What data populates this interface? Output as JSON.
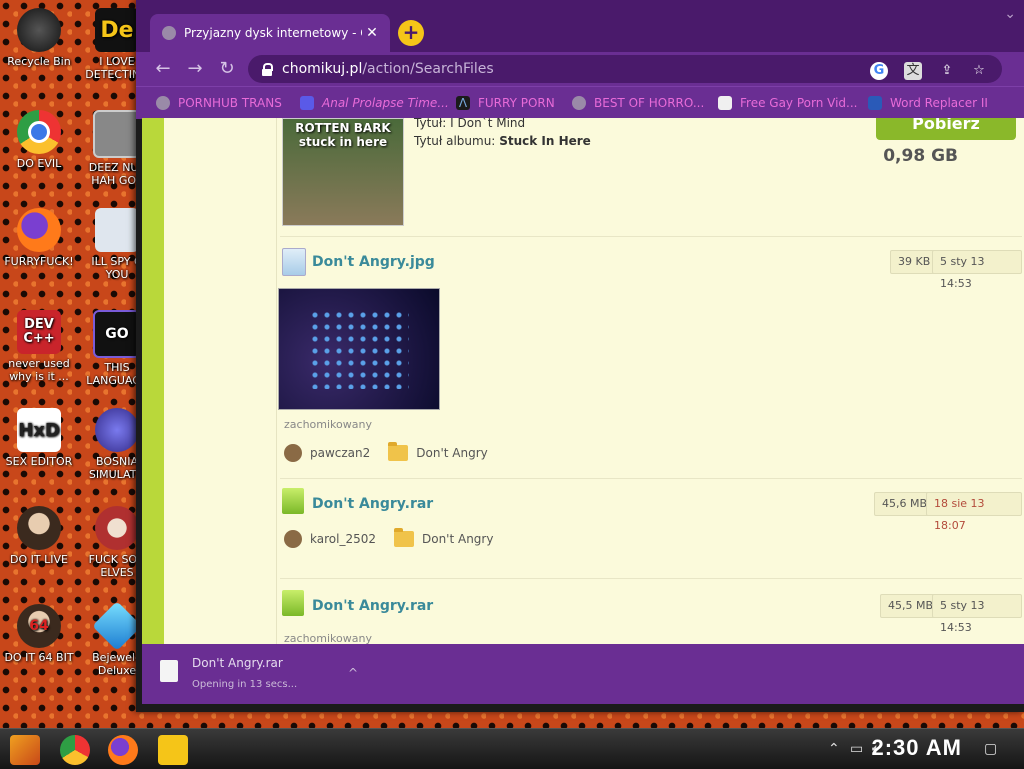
{
  "desktop": {
    "icons": [
      {
        "label": "Recycle Bin",
        "icon": "recycle-bin-icon"
      },
      {
        "label": "I LOVE\nDETECTING",
        "icon": "detective-game-icon"
      },
      {
        "label": "DO EVIL",
        "icon": "chrome-icon"
      },
      {
        "label": "DEEZ NUT\nHAH GOT",
        "icon": "windows-shortcut-icon"
      },
      {
        "label": "FURRYFUCK!",
        "icon": "firefox-icon"
      },
      {
        "label": "ILL SPY O\nYOU",
        "icon": "spy-icon"
      },
      {
        "label": "never used\nwhy is it ...",
        "icon": "devcpp-icon"
      },
      {
        "label": "THIS\nLANGUAGE",
        "icon": "go-language-icon"
      },
      {
        "label": "SEX EDITOR",
        "icon": "hxd-editor-icon"
      },
      {
        "label": "BOSNIA\nSIMULATO",
        "icon": "spiky-ball-icon"
      },
      {
        "label": "DO IT LIVE",
        "icon": "portrait-icon"
      },
      {
        "label": "FUCK SON\nELVES",
        "icon": "santa-icon"
      },
      {
        "label": "DO IT 64 BIT",
        "icon": "portrait-64-icon"
      },
      {
        "label": "Bejewele\nDeluxe",
        "icon": "diamond-icon"
      }
    ]
  },
  "browser": {
    "tab_title": "Przyjazny dysk internetowy - C",
    "tab_close": "✕",
    "new_tab": "+",
    "url_host": "chomikuj.pl",
    "url_path": "/action/SearchFiles",
    "bookmarks": [
      {
        "label": "PORNHUB TRANS"
      },
      {
        "label": "Anal Prolapse Time..."
      },
      {
        "label": "FURRY PORN"
      },
      {
        "label": "BEST OF HORRO..."
      },
      {
        "label": "Free Gay Porn Vid..."
      },
      {
        "label": "Word Replacer II"
      }
    ]
  },
  "page": {
    "first_item": {
      "cover_text": "ROTTEN BARK\nstuck in here",
      "title_label": "Tytuł:",
      "title_value": "I Don`t Mind",
      "album_label": "Tytuł albumu:",
      "album_value": "Stuck In Here",
      "download_button": "Pobierz",
      "size": "0,98 GB"
    },
    "files": [
      {
        "name": "Don't Angry.jpg",
        "size": "39 KB",
        "date": "5 sty 13 14:53",
        "status": "zachomikowany",
        "user": "pawczan2",
        "folder": "Don't Angry"
      },
      {
        "name": "Don't Angry.rar",
        "size": "45,6 MB",
        "date": "18 sie 13 18:07",
        "user": "karol_2502",
        "folder": "Don't Angry"
      },
      {
        "name": "Don't Angry.rar",
        "size": "45,5 MB",
        "date": "5 sty 13 14:53",
        "status": "zachomikowany"
      }
    ]
  },
  "download_shelf": {
    "file_name": "Don't Angry.rar",
    "status": "Opening in 13 secs...",
    "caret": "^"
  },
  "taskbar": {
    "clock": "2:30 AM"
  },
  "colors": {
    "browser_purple": "#6a2e93",
    "tab_dark_purple": "#4a1a6b",
    "bookmark_pink": "#e86bd8",
    "page_bg": "#fbfadb",
    "link_teal": "#3a8a9a",
    "date_red": "#b34b3b"
  }
}
